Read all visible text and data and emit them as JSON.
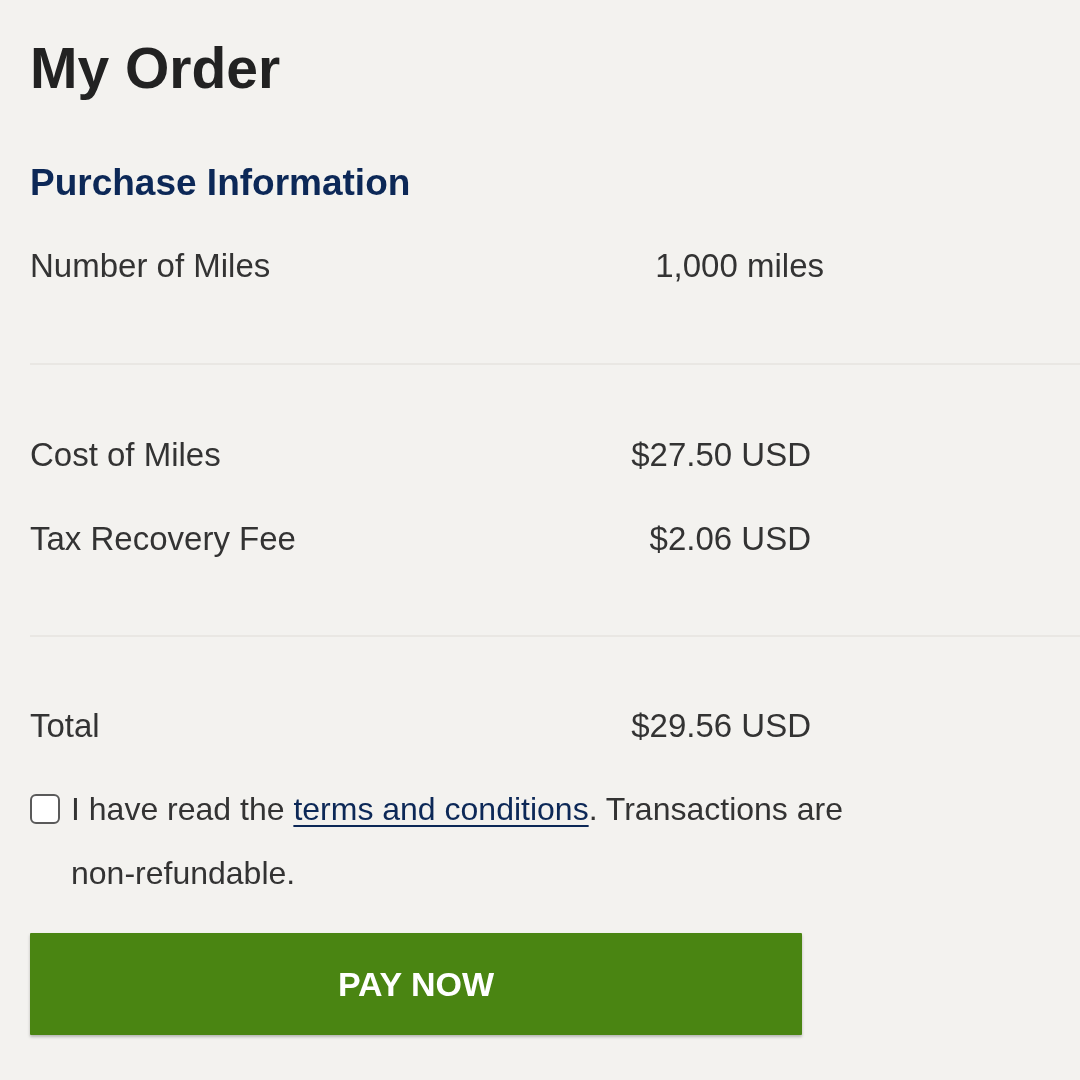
{
  "page": {
    "title": "My Order"
  },
  "purchase_information": {
    "heading": "Purchase Information",
    "rows": [
      {
        "label": "Number of Miles",
        "value": "1,000 miles"
      }
    ]
  },
  "charges": {
    "rows": [
      {
        "label": "Cost of Miles",
        "value": "$27.50 USD"
      },
      {
        "label": "Tax Recovery Fee",
        "value": "$2.06 USD"
      }
    ]
  },
  "total": {
    "label": "Total",
    "value": "$29.56 USD"
  },
  "agreement": {
    "checked": false,
    "text_before": "I have read the ",
    "link": "terms and conditions",
    "text_after": ". Transactions are non-refundable."
  },
  "pay_button": {
    "label": "PAY NOW"
  }
}
